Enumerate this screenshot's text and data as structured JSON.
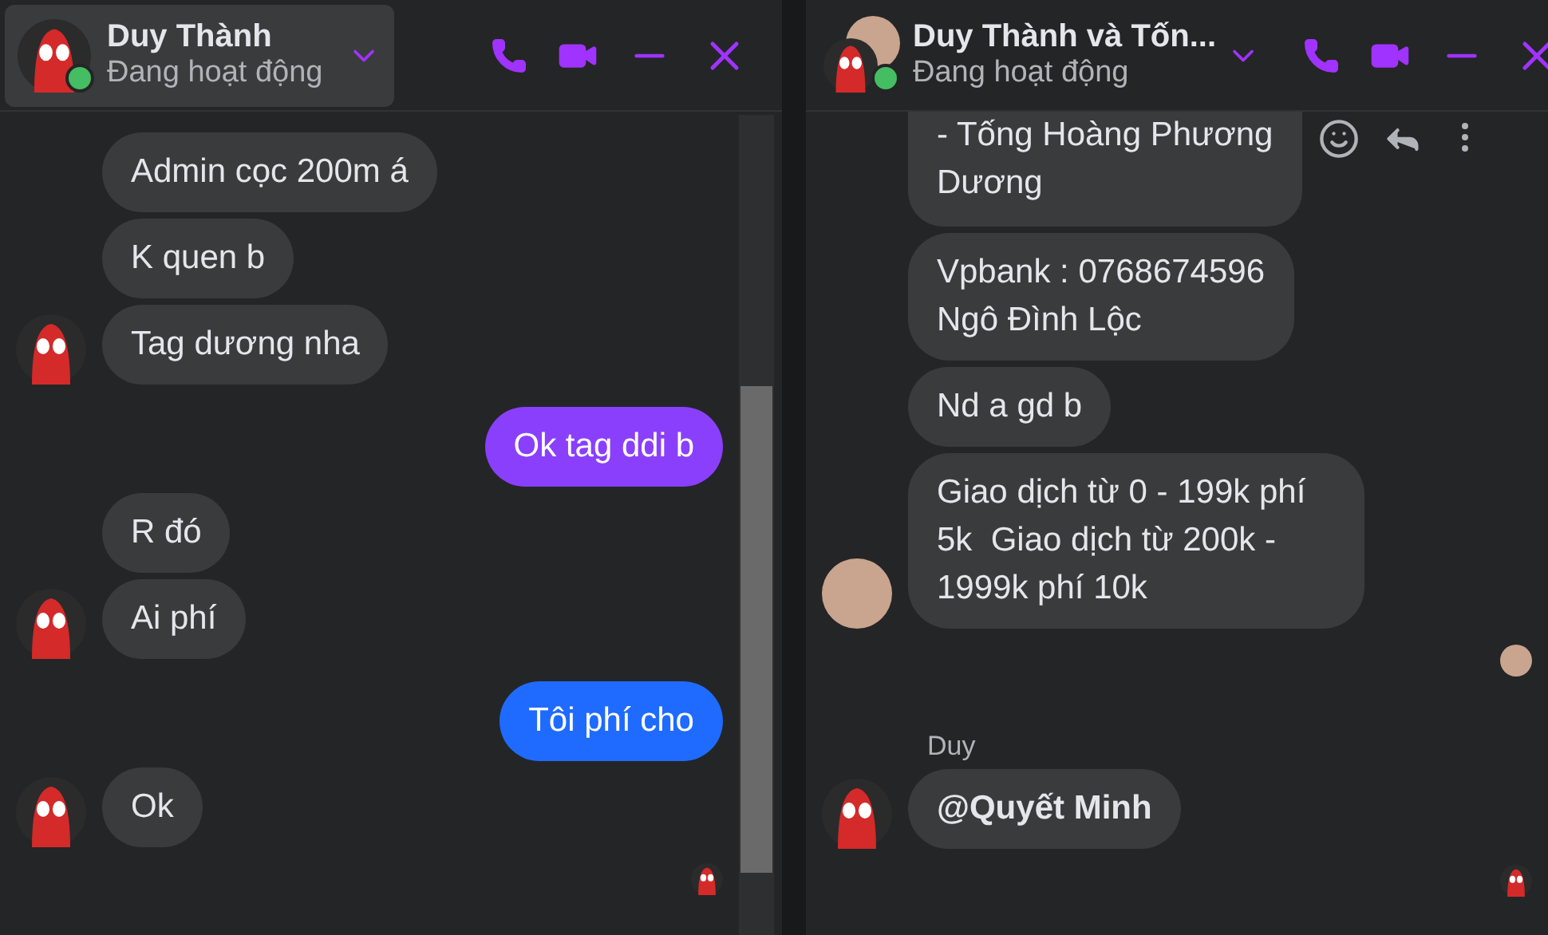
{
  "windows": [
    {
      "title": "Duy Thành",
      "status": "Đang hoạt động",
      "header_avatars": [
        {
          "kind": "spider"
        }
      ],
      "online": true,
      "header_hovered": true,
      "scrollbar": true,
      "messages": [
        {
          "kind": "received",
          "text": "Admin cọc 200m á"
        },
        {
          "kind": "received",
          "text": "K quen b"
        },
        {
          "kind": "received",
          "text": "Tag dương nha",
          "avatar": {
            "kind": "spider"
          }
        },
        {
          "kind": "sent",
          "text": "Ok tag ddi b",
          "color": "#8a3ffc"
        },
        {
          "kind": "received",
          "text": "R đó"
        },
        {
          "kind": "received",
          "text": "Ai phí",
          "avatar": {
            "kind": "spider"
          }
        },
        {
          "kind": "sent",
          "text": "Tôi phí cho",
          "color": "#1f6bff"
        },
        {
          "kind": "received",
          "text": "Ok",
          "avatar": {
            "kind": "spider"
          }
        },
        {
          "kind": "receipt",
          "avatar": {
            "kind": "spider"
          }
        }
      ]
    },
    {
      "title": "Duy Thành và Tốn...",
      "status": "Đang hoạt động",
      "header_avatars": [
        {
          "kind": "photo"
        },
        {
          "kind": "spider"
        }
      ],
      "online": true,
      "header_hovered": false,
      "scrollbar": false,
      "messages": [
        {
          "kind": "received",
          "text": "- Tống Hoàng Phương\nDương",
          "actions": true,
          "clipped": true
        },
        {
          "kind": "received",
          "text": "Vpbank : 0768674596\nNgô Đình Lộc"
        },
        {
          "kind": "received",
          "text": "Nd a gd b"
        },
        {
          "kind": "received",
          "text": "Giao dịch từ 0 - 199k phí 5k  Giao dịch từ 200k - 1999k phí 10k",
          "avatar": {
            "kind": "photo"
          }
        },
        {
          "kind": "receipt",
          "avatar": {
            "kind": "photo"
          }
        },
        {
          "kind": "sender",
          "text": "Duy"
        },
        {
          "kind": "received",
          "text": "@Quyết Minh",
          "avatar": {
            "kind": "spider"
          },
          "bold": true
        },
        {
          "kind": "receipt",
          "avatar": {
            "kind": "spider"
          }
        }
      ]
    }
  ]
}
